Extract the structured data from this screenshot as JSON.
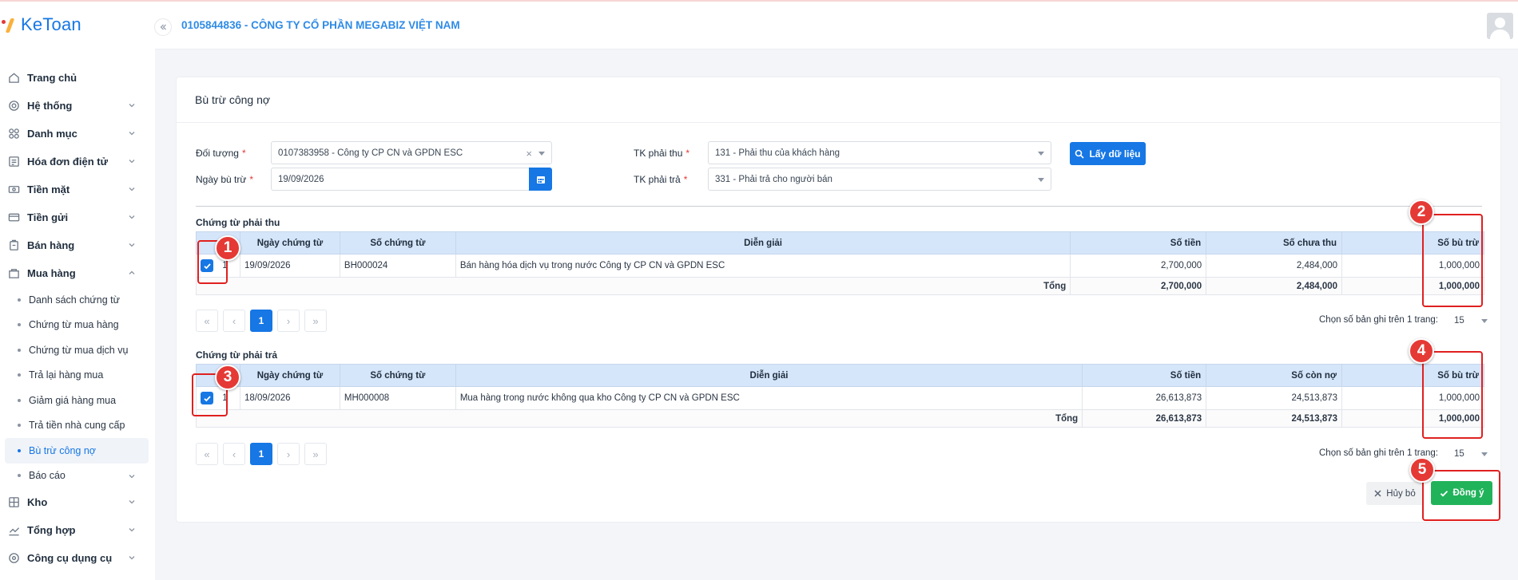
{
  "app": {
    "logo_text": "KeToan"
  },
  "header": {
    "company": "0105844836 - CÔNG TY CỔ PHẦN MEGABIZ VIỆT NAM"
  },
  "sidebar": {
    "items": [
      {
        "label": "Trang chủ",
        "icon": "home-icon"
      },
      {
        "label": "Hệ thống",
        "icon": "settings-icon"
      },
      {
        "label": "Danh mục",
        "icon": "category-icon"
      },
      {
        "label": "Hóa đơn điện tử",
        "icon": "invoice-icon"
      },
      {
        "label": "Tiền mặt",
        "icon": "cash-icon"
      },
      {
        "label": "Tiền gửi",
        "icon": "bank-icon"
      },
      {
        "label": "Bán hàng",
        "icon": "sales-icon"
      },
      {
        "label": "Mua hàng",
        "icon": "purchase-icon"
      }
    ],
    "purchase_sub": [
      "Danh sách chứng từ",
      "Chứng từ mua hàng",
      "Chứng từ mua dịch vụ",
      "Trả lại hàng mua",
      "Giảm giá hàng mua",
      "Trả tiền nhà cung cấp",
      "Bù trừ công nợ",
      "Báo cáo"
    ],
    "bottom_items": [
      {
        "label": "Kho",
        "icon": "warehouse-icon"
      },
      {
        "label": "Tổng hợp",
        "icon": "chart-icon"
      },
      {
        "label": "Công cụ dụng cụ",
        "icon": "tools-icon"
      }
    ]
  },
  "form": {
    "title": "Bù trừ công nợ",
    "doi_tuong_label": "Đối tượng",
    "doi_tuong_value": "0107383958 - Công ty CP CN và GPDN ESC",
    "ngay_label": "Ngày bù trừ",
    "ngay_value": "19/09/2026",
    "tk_thu_label": "TK phải thu",
    "tk_thu_value": "131 - Phải thu của khách hàng",
    "tk_tra_label": "TK phải trả",
    "tk_tra_value": "331 - Phải trả cho người bán",
    "fetch_button": "Lấy dữ liệu"
  },
  "receivable": {
    "title": "Chứng từ phải thu",
    "headers": [
      "STT",
      "Ngày chứng từ",
      "Số chứng từ",
      "Diễn giải",
      "Số tiền",
      "Số chưa thu",
      "Số bù trừ"
    ],
    "rows": [
      {
        "stt": "1",
        "date": "19/09/2026",
        "doc": "BH000024",
        "desc": "Bán hàng hóa dịch vụ trong nước Công ty CP CN và GPDN ESC",
        "amount": "2,700,000",
        "remaining": "2,484,000",
        "offset": "1,000,000"
      }
    ],
    "total_label": "Tổng",
    "total_amount": "2,700,000",
    "total_remaining": "2,484,000",
    "total_offset": "1,000,000"
  },
  "payable": {
    "title": "Chứng từ phải trả",
    "headers": [
      "STT",
      "Ngày chứng từ",
      "Số chứng từ",
      "Diễn giải",
      "Số tiền",
      "Số còn nợ",
      "Số bù trừ"
    ],
    "rows": [
      {
        "stt": "1",
        "date": "18/09/2026",
        "doc": "MH000008",
        "desc": "Mua hàng trong nước không qua kho Công ty CP CN và GPDN ESC",
        "amount": "26,613,873",
        "remaining": "24,513,873",
        "offset": "1,000,000"
      }
    ],
    "total_label": "Tổng",
    "total_amount": "26,613,873",
    "total_remaining": "24,513,873",
    "total_offset": "1,000,000"
  },
  "pagination": {
    "current_page": "1",
    "page_size_label": "Chọn số bản ghi trên 1 trang:",
    "page_size": "15"
  },
  "actions": {
    "cancel": "Hủy bỏ",
    "ok": "Đồng ý"
  },
  "callouts": [
    "1",
    "2",
    "3",
    "4",
    "5"
  ],
  "colors": {
    "primary": "#1677e5",
    "success": "#21b35a",
    "highlight": "#e02020",
    "header_row": "#d6e6fa"
  }
}
